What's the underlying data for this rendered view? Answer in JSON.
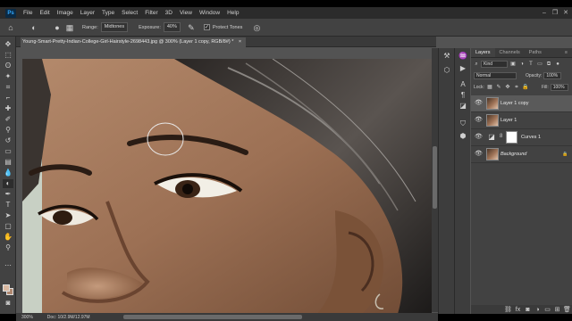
{
  "menubar": {
    "logo": "Ps",
    "items": [
      "File",
      "Edit",
      "Image",
      "Layer",
      "Type",
      "Select",
      "Filter",
      "3D",
      "View",
      "Window",
      "Help"
    ]
  },
  "options": {
    "range_label": "Range:",
    "range_value": "Midtones",
    "exposure_label": "Exposure:",
    "exposure_value": "40%",
    "protect_tones_label": "Protect Tones",
    "protect_tones_checked": true
  },
  "document": {
    "tab_title": "Young-Smart-Pretty-Indian-College-Girl-Hairstyle-2698443.jpg @ 300% (Layer 1 copy, RGB/8#) *",
    "close_glyph": "×"
  },
  "status": {
    "zoom": "300%",
    "doc_size": "Doc: 10/2.9M/12.97M"
  },
  "layers_panel": {
    "tabs": [
      "Layers",
      "Channels",
      "Paths"
    ],
    "active_tab": "Layers",
    "filter_kind": "Kind",
    "blend_mode": "Normal",
    "opacity_label": "Opacity:",
    "opacity_value": "100%",
    "lock_label": "Lock:",
    "fill_label": "Fill:",
    "fill_value": "100%",
    "layers": [
      {
        "name": "Layer 1 copy",
        "selected": true,
        "type": "pixel"
      },
      {
        "name": "Layer 1",
        "selected": false,
        "type": "pixel"
      },
      {
        "name": "Curves 1",
        "selected": false,
        "type": "adjustment"
      },
      {
        "name": "Background",
        "selected": false,
        "type": "pixel",
        "italic": true
      }
    ]
  },
  "colors": {
    "app_bg": "#535353",
    "panel_bg": "#424242",
    "menubar_bg": "#2b2b2b",
    "accent_blue": "#31a8ff"
  }
}
